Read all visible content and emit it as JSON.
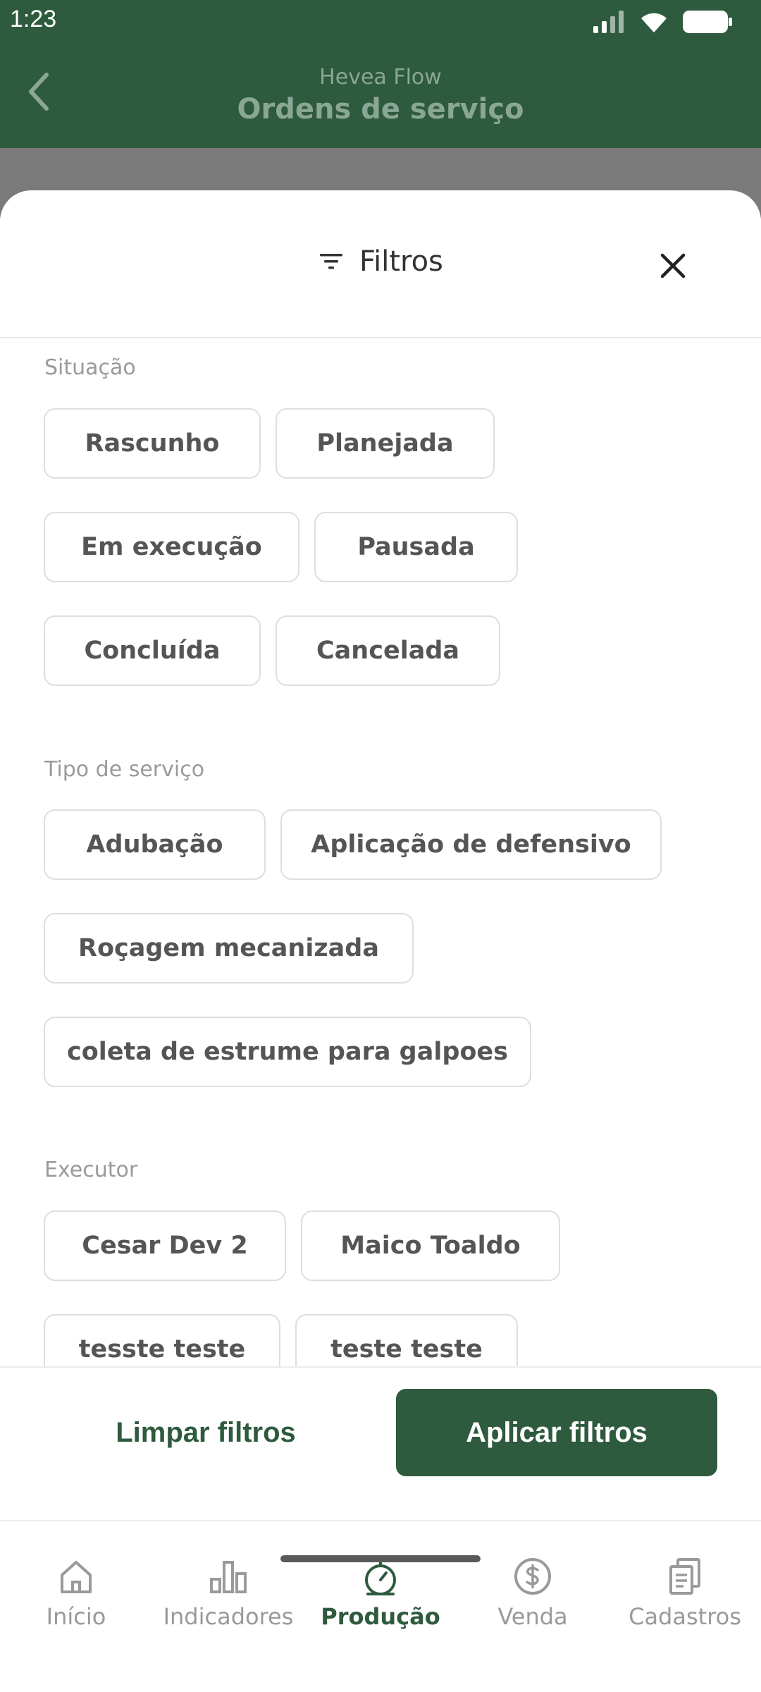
{
  "status_bar": {
    "time": "1:23"
  },
  "header": {
    "subtitle": "Hevea Flow",
    "title": "Ordens de serviço"
  },
  "sheet": {
    "title": "Filtros",
    "sections": {
      "situacao": {
        "label": "Situação",
        "chips": [
          "Rascunho",
          "Planejada",
          "Em execução",
          "Pausada",
          "Concluída",
          "Cancelada"
        ]
      },
      "tipo_servico": {
        "label": "Tipo de serviço",
        "chips": [
          "Adubação",
          "Aplicação de defensivo",
          "Roçagem mecanizada",
          "coleta de estrume para galpoes"
        ]
      },
      "executor": {
        "label": "Executor",
        "chips": [
          "Cesar Dev 2",
          "Maico Toaldo",
          "tesste teste",
          "teste teste"
        ]
      }
    },
    "footer": {
      "clear_label": "Limpar filtros",
      "apply_label": "Aplicar filtros"
    }
  },
  "colors": {
    "primary": "#2e5a3d",
    "chip_border": "#dedede",
    "muted": "#9a9a9a"
  },
  "bottom_nav": {
    "items": [
      {
        "label": "Início",
        "icon": "home-icon"
      },
      {
        "label": "Indicadores",
        "icon": "bar-chart-icon"
      },
      {
        "label": "Produção",
        "icon": "scale-icon",
        "active": true
      },
      {
        "label": "Venda",
        "icon": "dollar-icon"
      },
      {
        "label": "Cadastros",
        "icon": "documents-icon"
      }
    ]
  }
}
